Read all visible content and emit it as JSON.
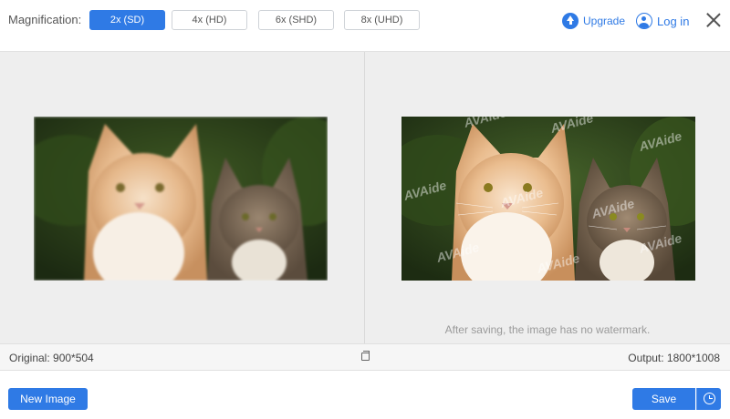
{
  "header": {
    "magnification_label": "Magnification:",
    "options": [
      "2x (SD)",
      "4x (HD)",
      "6x (SHD)",
      "8x (UHD)"
    ],
    "selected": "2x (SD)",
    "upgrade_label": "Upgrade",
    "login_label": "Log in"
  },
  "preview": {
    "watermark_text": "AVAide",
    "note": "After saving, the image has no watermark."
  },
  "status": {
    "original": "Original: 900*504",
    "output": "Output: 1800*1008"
  },
  "footer": {
    "new_image_label": "New Image",
    "save_label": "Save"
  },
  "colors": {
    "accent": "#2f7ae5",
    "panel_bg": "#eeeeee"
  }
}
